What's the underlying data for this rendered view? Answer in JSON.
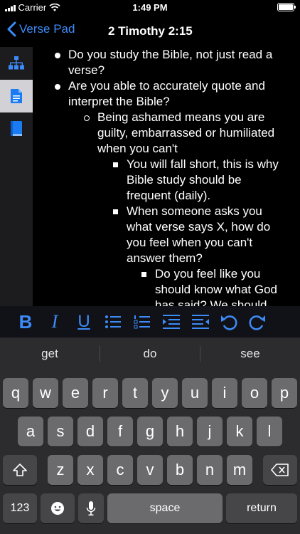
{
  "status_bar": {
    "carrier": "Carrier",
    "time": "1:49 PM"
  },
  "nav": {
    "back_label": "Verse Pad",
    "title": "2 Timothy 2:15"
  },
  "sidebar": {
    "items": [
      {
        "icon": "hierarchy-icon",
        "active": false
      },
      {
        "icon": "document-icon",
        "active": true
      },
      {
        "icon": "book-icon",
        "active": false
      }
    ]
  },
  "notes": {
    "items": [
      {
        "level": 1,
        "text": "Do you study the Bible, not just read a verse?"
      },
      {
        "level": 1,
        "text": "Are you able to accurately quote and interpret the Bible?"
      },
      {
        "level": 2,
        "text": "Being ashamed means you are guilty, embarrassed or humiliated when you can't"
      },
      {
        "level": 3,
        "text": "You will fall short, this is why Bible study should be frequent (daily)."
      },
      {
        "level": 3,
        "text": "When someone asks you what verse says X, how do you feel when you can't answer them?"
      },
      {
        "level": 4,
        "text": "Do you feel like you should know what God has said? We should"
      }
    ]
  },
  "format_toolbar": {
    "bold": "B",
    "italic": "I",
    "underline": "U"
  },
  "keyboard": {
    "suggestions": [
      "get",
      "do",
      "see"
    ],
    "row1": [
      "q",
      "w",
      "e",
      "r",
      "t",
      "y",
      "u",
      "i",
      "o",
      "p"
    ],
    "row2": [
      "a",
      "s",
      "d",
      "f",
      "g",
      "h",
      "j",
      "k",
      "l"
    ],
    "row3": [
      "z",
      "x",
      "c",
      "v",
      "b",
      "n",
      "m"
    ],
    "numbers_label": "123",
    "space_label": "space",
    "return_label": "return"
  },
  "colors": {
    "accent": "#3d8bf8",
    "background": "#000000",
    "keyboard": "#2c2c2e"
  }
}
